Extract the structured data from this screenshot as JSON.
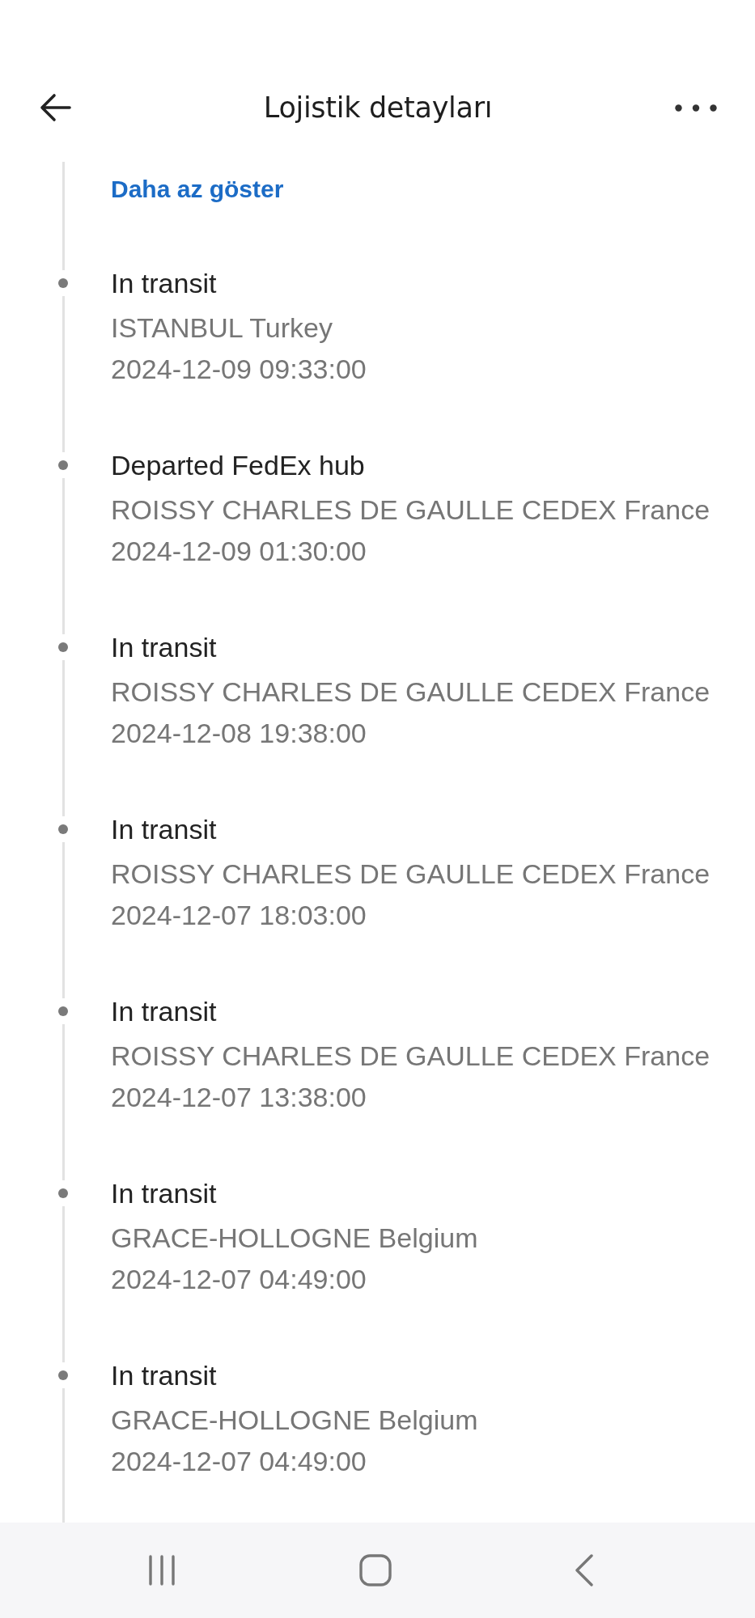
{
  "header": {
    "title": "Lojistik detayları"
  },
  "timeline": {
    "toggle_link": "Daha az göster",
    "events": [
      {
        "status": "In transit",
        "location": "ISTANBUL Turkey",
        "time": "2024-12-09 09:33:00"
      },
      {
        "status": "Departed FedEx hub",
        "location": "ROISSY CHARLES DE GAULLE CEDEX France",
        "time": "2024-12-09 01:30:00"
      },
      {
        "status": "In transit",
        "location": "ROISSY CHARLES DE GAULLE CEDEX France",
        "time": "2024-12-08 19:38:00"
      },
      {
        "status": "In transit",
        "location": "ROISSY CHARLES DE GAULLE CEDEX France",
        "time": "2024-12-07 18:03:00"
      },
      {
        "status": "In transit",
        "location": "ROISSY CHARLES DE GAULLE CEDEX France",
        "time": "2024-12-07 13:38:00"
      },
      {
        "status": "In transit",
        "location": "GRACE-HOLLOGNE Belgium",
        "time": "2024-12-07 04:49:00"
      },
      {
        "status": "In transit",
        "location": "GRACE-HOLLOGNE Belgium",
        "time": "2024-12-07 04:49:00"
      }
    ]
  }
}
